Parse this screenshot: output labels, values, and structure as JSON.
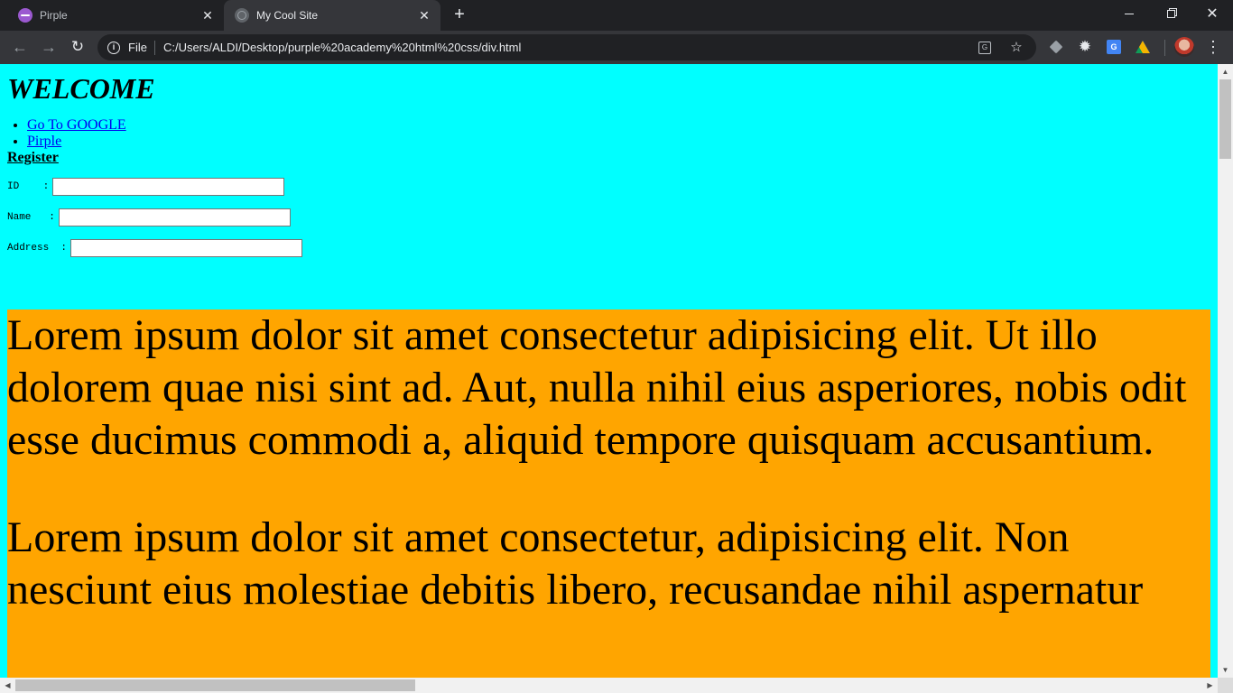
{
  "browser": {
    "tabs": [
      {
        "title": "Pirple",
        "icon": "pirple-favicon-icon",
        "active": false
      },
      {
        "title": "My Cool Site",
        "icon": "globe-favicon-icon",
        "active": true
      }
    ],
    "new_tab_label": "+",
    "window_controls": {
      "minimize": "minimize",
      "maximize": "restore",
      "close": "✕"
    },
    "toolbar": {
      "back_icon": "arrow-left-icon",
      "forward_icon": "arrow-right-icon",
      "reload_icon": "reload-icon",
      "scheme_label": "File",
      "url": "C:/Users/ALDI/Desktop/purple%20academy%20html%20css/div.html",
      "extensions": [
        "translate-icon",
        "bookmark-star-icon",
        "layers-extension-icon",
        "settings-extension-icon",
        "google-translate-extension-icon",
        "drive-extension-icon"
      ],
      "menu_icon": "more-vert-icon"
    }
  },
  "page": {
    "background": "#00ffff",
    "heading": "WELCOME",
    "links": [
      {
        "label": "Go To GOOGLE"
      },
      {
        "label": "Pirple"
      }
    ],
    "register_title": "Register",
    "form": {
      "fields": [
        {
          "label": "ID    :",
          "value": ""
        },
        {
          "label": "Name   :",
          "value": ""
        },
        {
          "label": "Address  :",
          "value": ""
        }
      ]
    },
    "content_background": "#ffa500",
    "paragraphs": [
      "Lorem ipsum dolor sit amet consectetur adipisicing elit. Ut illo dolorem quae nisi sint ad. Aut, nulla nihil eius asperiores, nobis odit esse ducimus commodi a, aliquid tempore quisquam accusantium.",
      "Lorem ipsum dolor sit amet consectetur, adipisicing elit. Non nesciunt eius molestiae debitis libero, recusandae nihil aspernatur"
    ]
  }
}
